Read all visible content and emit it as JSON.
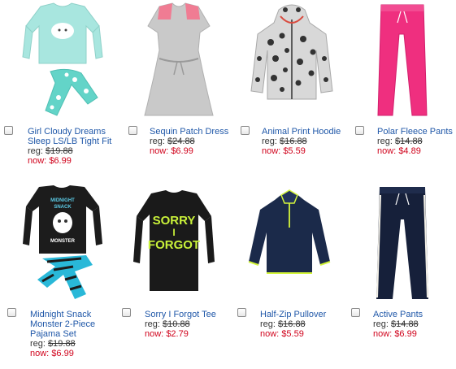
{
  "labels": {
    "reg": "reg:",
    "now": "now:"
  },
  "products": [
    {
      "name": "Girl Cloudy Dreams Sleep LS/LB Tight Fit",
      "reg": "$19.88",
      "now": "$6.99"
    },
    {
      "name": "Sequin Patch Dress",
      "reg": "$24.88",
      "now": "$6.99"
    },
    {
      "name": "Animal Print Hoodie",
      "reg": "$16.88",
      "now": "$5.59"
    },
    {
      "name": "Polar Fleece Pants",
      "reg": "$14.88",
      "now": "$4.89"
    },
    {
      "name": "Midnight Snack Monster 2-Piece Pajama Set",
      "reg": "$19.88",
      "now": "$6.99"
    },
    {
      "name": "Sorry I Forgot Tee",
      "reg": "$10.88",
      "now": "$2.79"
    },
    {
      "name": "Half-Zip Pullover",
      "reg": "$16.88",
      "now": "$5.59"
    },
    {
      "name": "Active Pants",
      "reg": "$14.88",
      "now": "$6.99"
    }
  ],
  "print": {
    "tee_line1": "SORRY",
    "tee_line2": "I",
    "tee_line3": "FORGOT",
    "pj_line1": "MIDNIGHT",
    "pj_line2": "SNACK",
    "pj_line3": "MONSTER"
  }
}
